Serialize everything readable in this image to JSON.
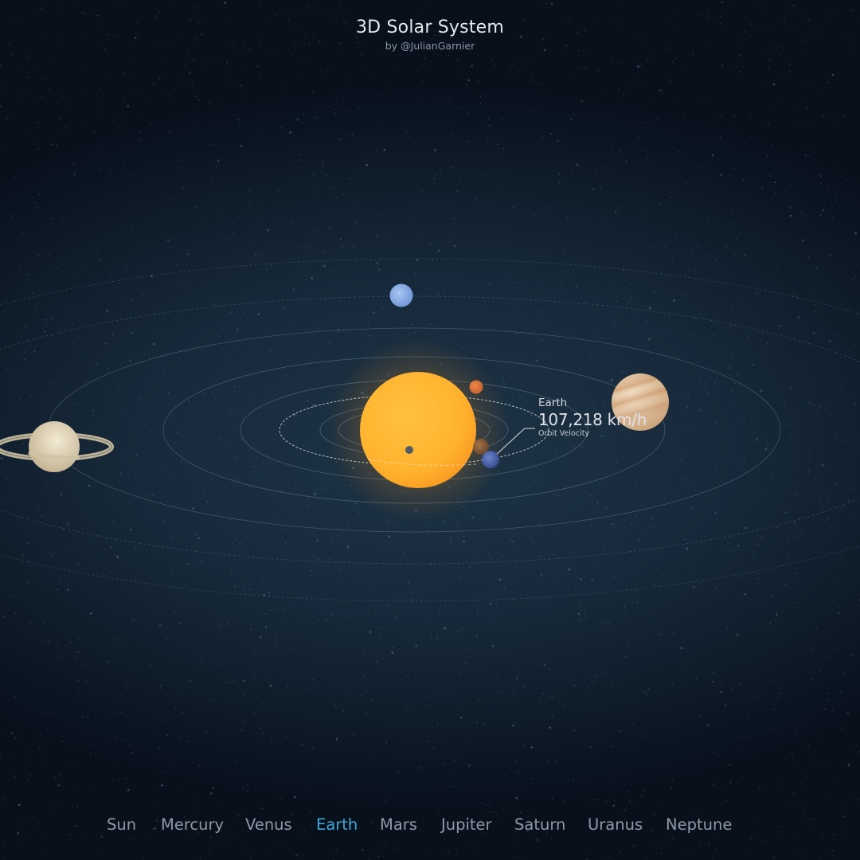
{
  "header": {
    "title": "3D Solar System",
    "subtitle": "by @JulianGarnier"
  },
  "info_panel": {
    "planet": "Earth",
    "value": "107,218 km/h",
    "caption": "Orbit Velocity"
  },
  "nav": {
    "items": [
      {
        "label": "Sun",
        "active": false
      },
      {
        "label": "Mercury",
        "active": false
      },
      {
        "label": "Venus",
        "active": false
      },
      {
        "label": "Earth",
        "active": true
      },
      {
        "label": "Mars",
        "active": false
      },
      {
        "label": "Jupiter",
        "active": false
      },
      {
        "label": "Saturn",
        "active": false
      },
      {
        "label": "Uranus",
        "active": false
      },
      {
        "label": "Neptune",
        "active": false
      }
    ]
  },
  "colors": {
    "accent": "#3fa7d6",
    "sun": "#ffb52e",
    "mercury": "#5b6570",
    "venus": "#a9693a",
    "earth": "#4a63b0",
    "mars": "#d9703a",
    "jupiter": "#d8b38a",
    "saturn": "#d6c9a8",
    "uranus": "#8fb2e8",
    "neptune": "#8fb2e8"
  },
  "planets": [
    "Sun",
    "Mercury",
    "Venus",
    "Earth",
    "Mars",
    "Jupiter",
    "Saturn",
    "Uranus",
    "Neptune"
  ]
}
